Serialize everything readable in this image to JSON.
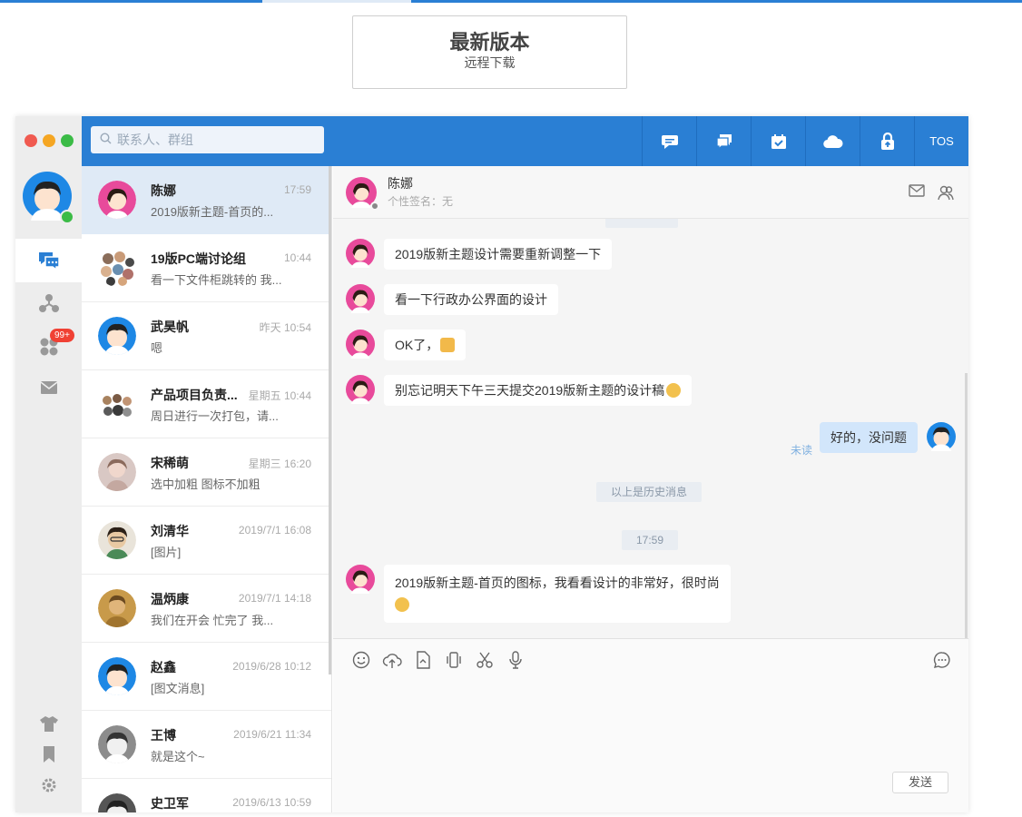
{
  "page": {
    "download_title": "最新版本",
    "download_sub": "远程下载"
  },
  "colors": {
    "accent": "#2a7fd4",
    "active_row": "#dfeaf6",
    "my_bubble": "#d2e6fb",
    "badge": "#f04134"
  },
  "sidebar": {
    "badge": "99+",
    "icons": [
      "chat-icon",
      "org-icon",
      "apps-icon",
      "mail-icon",
      "skin-icon",
      "bookmark-icon",
      "settings-icon"
    ]
  },
  "header": {
    "search_placeholder": "联系人、群组",
    "tos_label": "TOS",
    "buttons": [
      "chat-bubble-icon",
      "message-icon",
      "calendar-icon",
      "cloud-icon",
      "lock-icon"
    ]
  },
  "conversations": [
    {
      "name": "陈娜",
      "time": "17:59",
      "preview": "2019版新主题-首页的..."
    },
    {
      "name": "19版PC端讨论组",
      "time": "10:44",
      "preview": "看一下文件柜跳转的 我..."
    },
    {
      "name": "武昊帆",
      "time": "昨天 10:54",
      "preview": "嗯"
    },
    {
      "name": "产品项目负责...",
      "time": "星期五 10:44",
      "preview": "周日进行一次打包，请..."
    },
    {
      "name": "宋稀萌",
      "time": "星期三 16:20",
      "preview": "选中加粗 图标不加粗"
    },
    {
      "name": "刘清华",
      "time": "2019/7/1 16:08",
      "preview": "[图片]"
    },
    {
      "name": "温炳康",
      "time": "2019/7/1 14:18",
      "preview": "我们在开会 忙完了 我..."
    },
    {
      "name": "赵鑫",
      "time": "2019/6/28 10:12",
      "preview": "[图文消息]"
    },
    {
      "name": "王博",
      "time": "2019/6/21 11:34",
      "preview": "就是这个~"
    },
    {
      "name": "史卫军",
      "time": "2019/6/13 10:59",
      "preview": ""
    }
  ],
  "chat": {
    "name": "陈娜",
    "signature": "个性签名：无",
    "messages": [
      {
        "text": "2019版新主题设计需要重新调整一下"
      },
      {
        "text": "看一下行政办公界面的设计"
      },
      {
        "text": "OK了，"
      },
      {
        "text": "别忘记明天下午三天提交2019版新主题的设计稿"
      },
      {
        "text": "好的，没问题"
      },
      {
        "text": "2019版新主题-首页的图标，我看看设计的非常好，很时尚"
      }
    ],
    "unread": "未读",
    "history_label": "以上是历史消息",
    "time_label": "17:59",
    "send_label": "发送"
  }
}
